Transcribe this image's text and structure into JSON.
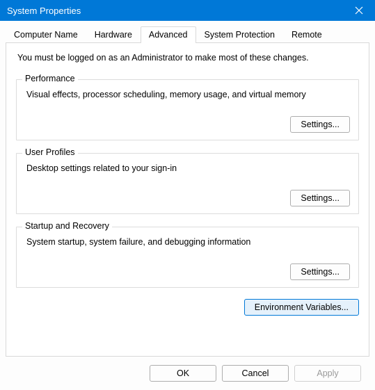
{
  "window": {
    "title": "System Properties"
  },
  "tabs": {
    "computer_name": "Computer Name",
    "hardware": "Hardware",
    "advanced": "Advanced",
    "system_protection": "System Protection",
    "remote": "Remote"
  },
  "intro": "You must be logged on as an Administrator to make most of these changes.",
  "groups": {
    "performance": {
      "title": "Performance",
      "desc": "Visual effects, processor scheduling, memory usage, and virtual memory",
      "button": "Settings..."
    },
    "user_profiles": {
      "title": "User Profiles",
      "desc": "Desktop settings related to your sign-in",
      "button": "Settings..."
    },
    "startup": {
      "title": "Startup and Recovery",
      "desc": "System startup, system failure, and debugging information",
      "button": "Settings..."
    }
  },
  "env_button": "Environment Variables...",
  "footer": {
    "ok": "OK",
    "cancel": "Cancel",
    "apply": "Apply"
  }
}
